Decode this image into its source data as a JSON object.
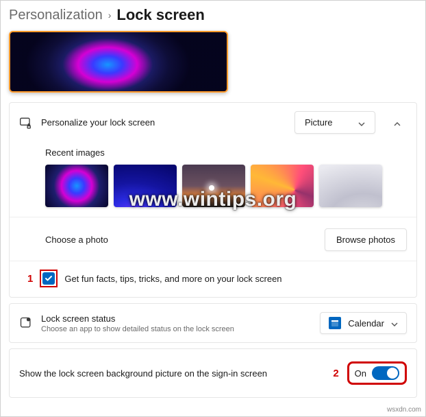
{
  "breadcrumb": {
    "parent": "Personalization",
    "sep": "›",
    "current": "Lock screen"
  },
  "personalize": {
    "label": "Personalize your lock screen",
    "dropdown_value": "Picture",
    "recent_label": "Recent images",
    "choose_label": "Choose a photo",
    "browse_label": "Browse photos",
    "funfacts_label": "Get fun facts, tips, tricks, and more on your lock screen"
  },
  "status": {
    "title": "Lock screen status",
    "desc": "Choose an app to show detailed status on the lock screen",
    "dropdown_value": "Calendar"
  },
  "signin": {
    "label": "Show the lock screen background picture on the sign-in screen",
    "toggle_label": "On"
  },
  "annotations": {
    "one": "1",
    "two": "2"
  },
  "watermark": "www.wintips.org",
  "source": "wsxdn.com"
}
